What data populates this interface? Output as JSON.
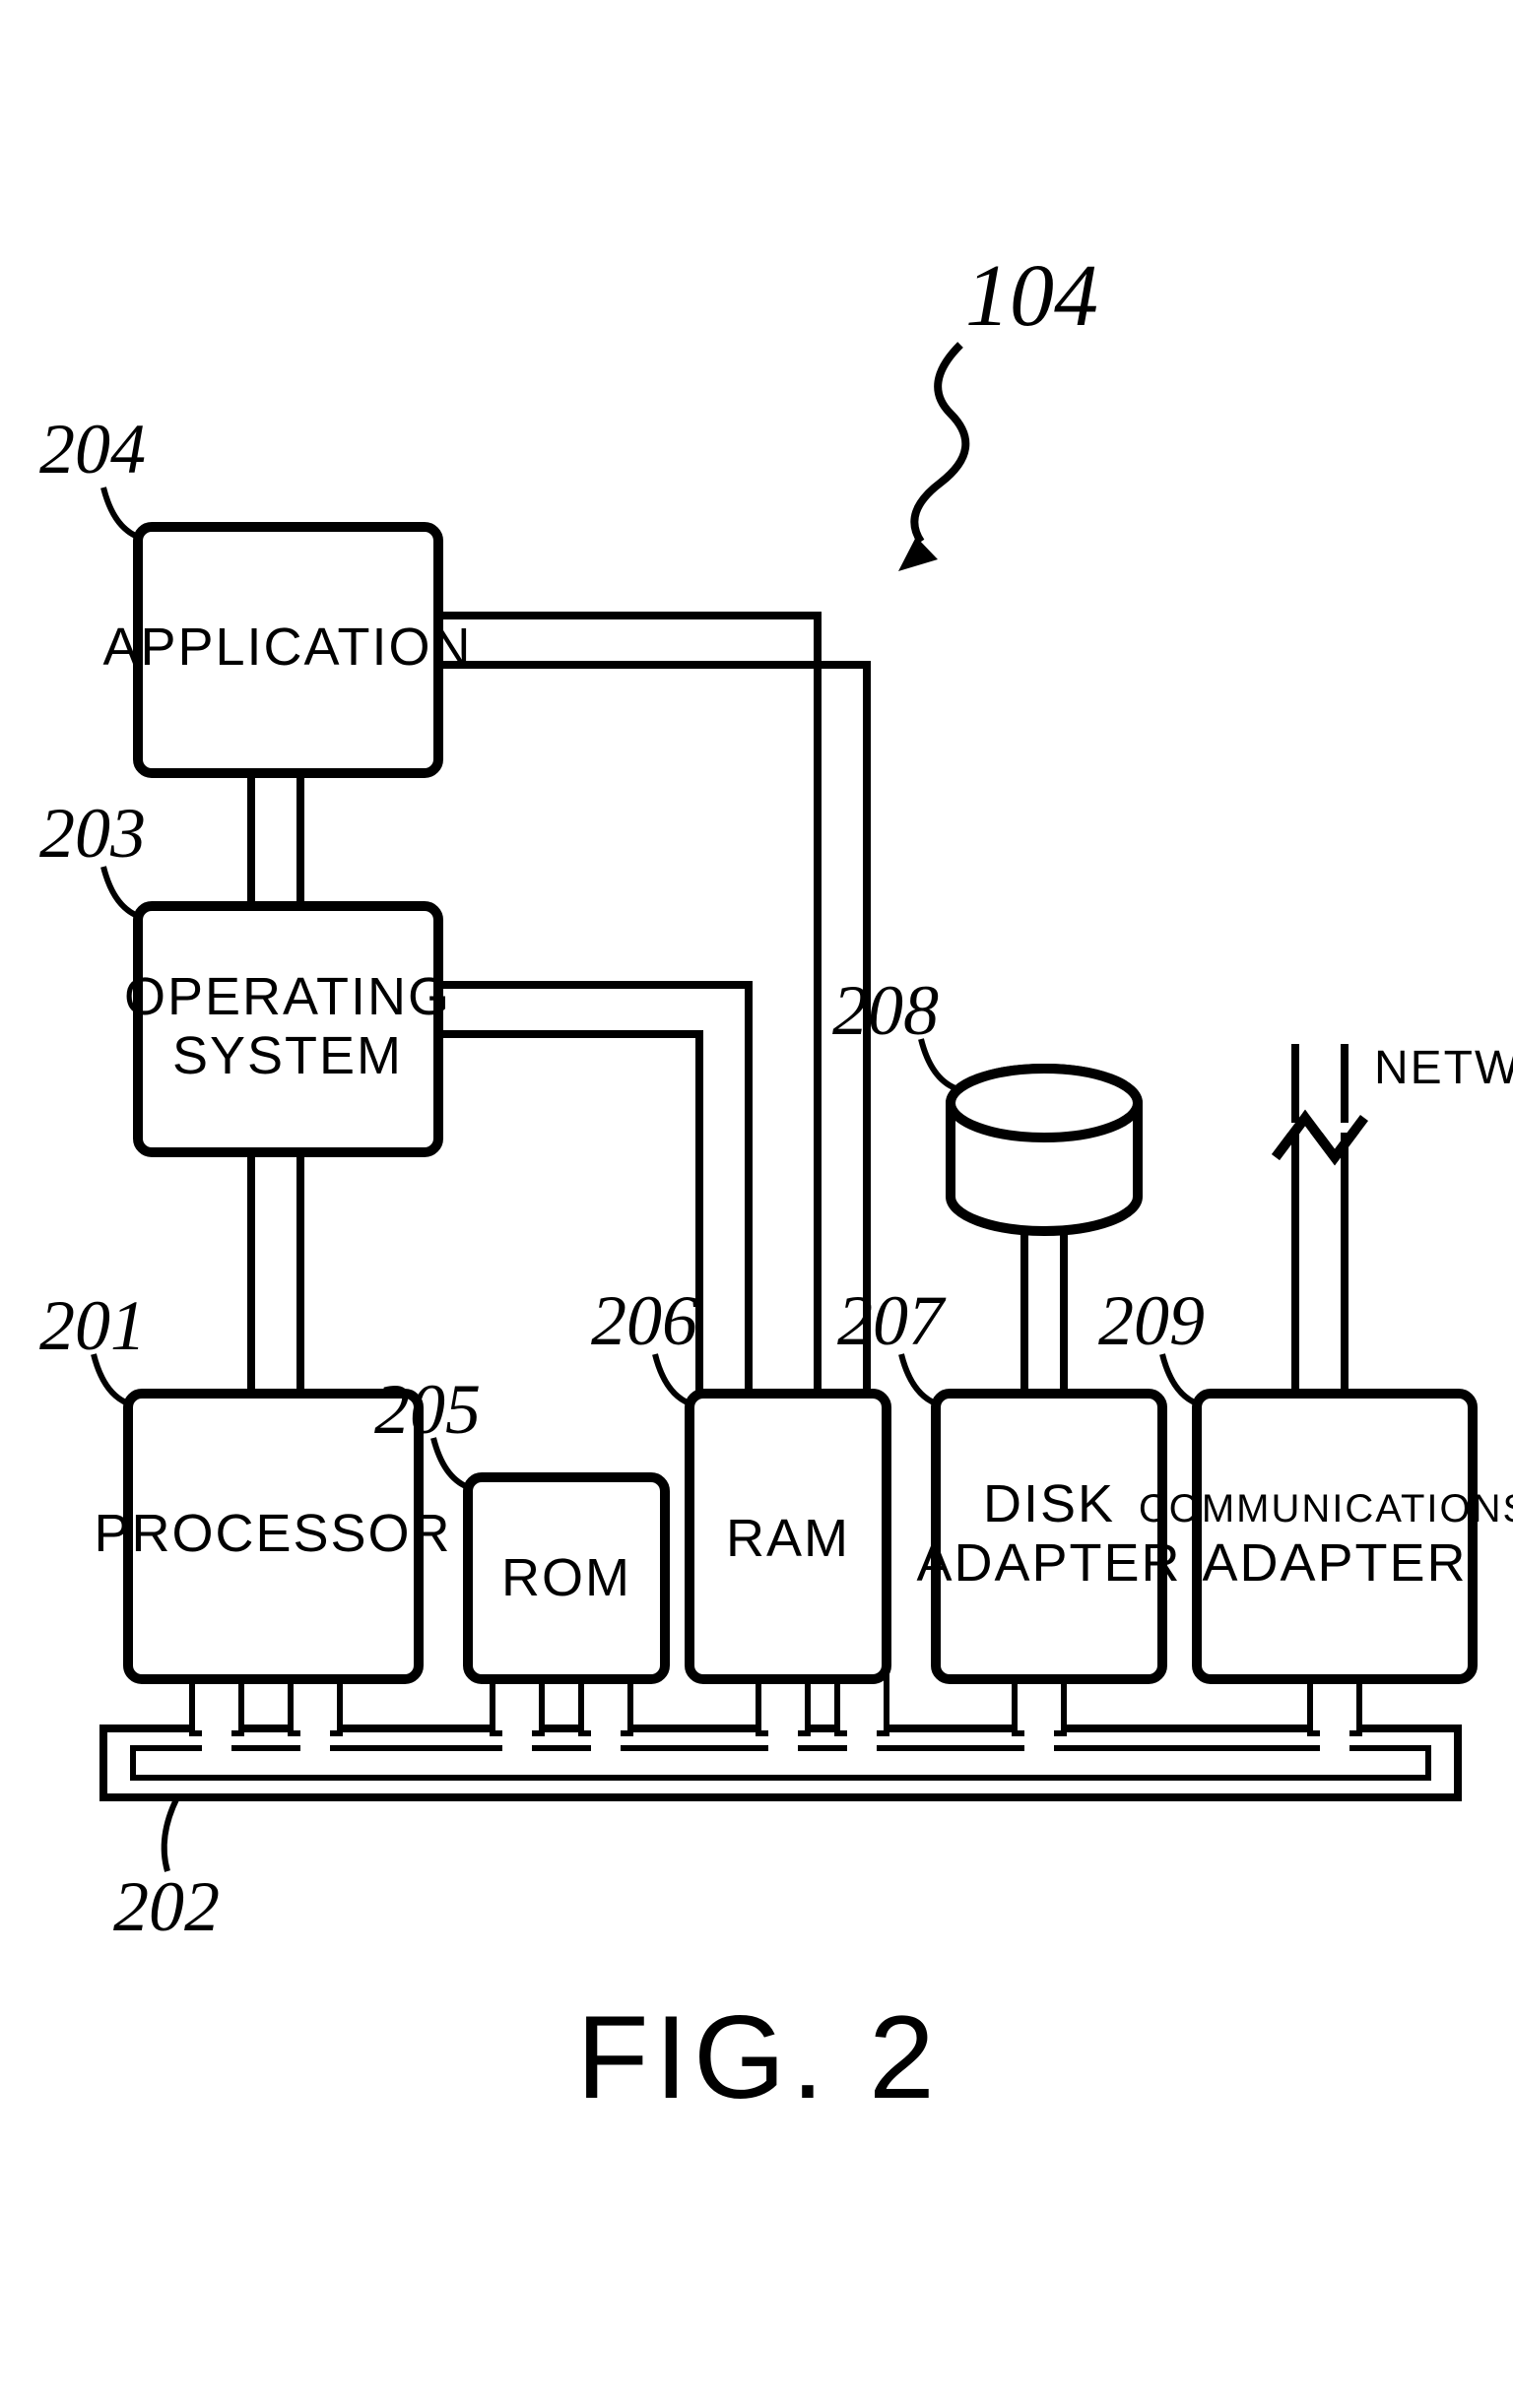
{
  "figure": {
    "ref_callout": "104",
    "caption": "FIG. 2"
  },
  "blocks": {
    "application": {
      "label": "APPLICATION",
      "callout": "204"
    },
    "os": {
      "label_line1": "OPERATING",
      "label_line2": "SYSTEM",
      "callout": "203"
    },
    "processor": {
      "label": "PROCESSOR",
      "callout": "201"
    },
    "rom": {
      "label": "ROM",
      "callout": "205"
    },
    "ram": {
      "label": "RAM",
      "callout": "206"
    },
    "disk": {
      "label_line1": "DISK",
      "label_line2": "ADAPTER",
      "callout": "207",
      "storage_callout": "208"
    },
    "comms": {
      "label_line1": "COMMUNICATIONS",
      "label_line2": "ADAPTER",
      "callout": "209"
    }
  },
  "bus": {
    "callout": "202"
  },
  "network": {
    "label": "NETWORK"
  }
}
